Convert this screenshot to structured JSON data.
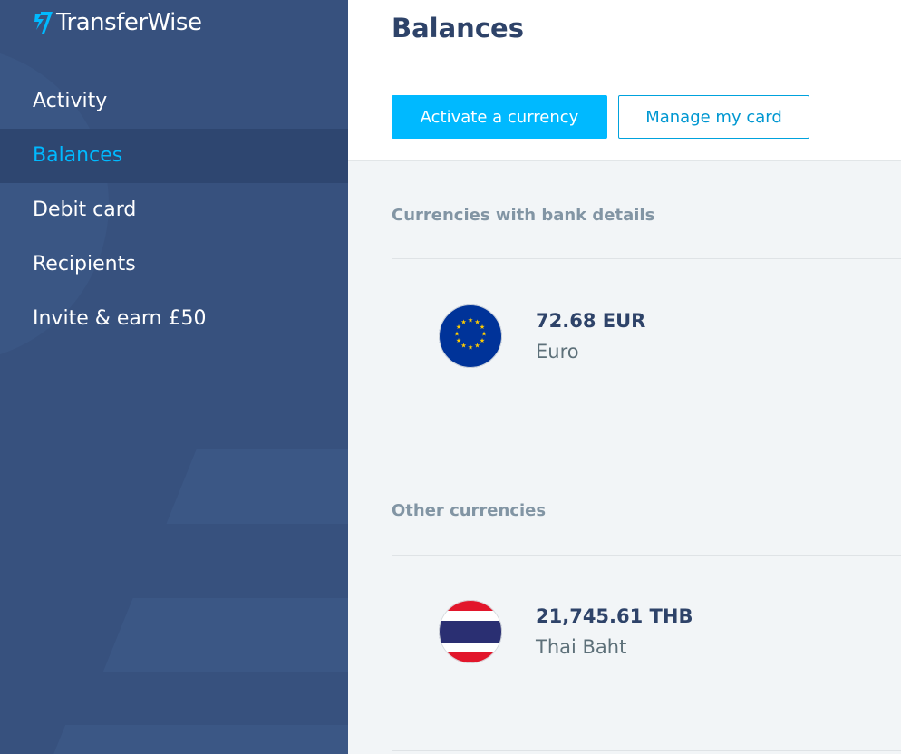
{
  "app": {
    "logo_text": "TransferWise",
    "brand_color": "#00b9ff"
  },
  "sidebar": {
    "items": [
      {
        "label": "Activity",
        "active": false
      },
      {
        "label": "Balances",
        "active": true
      },
      {
        "label": "Debit card",
        "active": false
      },
      {
        "label": "Recipients",
        "active": false
      },
      {
        "label": "Invite & earn £50",
        "active": false
      }
    ]
  },
  "header": {
    "title": "Balances"
  },
  "toolbar": {
    "activate_label": "Activate a currency",
    "manage_label": "Manage my card"
  },
  "sections": [
    {
      "heading": "Currencies with bank details",
      "currencies": [
        {
          "amount": "72.68 EUR",
          "name": "Euro",
          "flag_icon": "eu-flag-icon"
        }
      ]
    },
    {
      "heading": "Other currencies",
      "currencies": [
        {
          "amount": "21,745.61 THB",
          "name": "Thai Baht",
          "flag_icon": "thailand-flag-icon"
        }
      ]
    }
  ]
}
